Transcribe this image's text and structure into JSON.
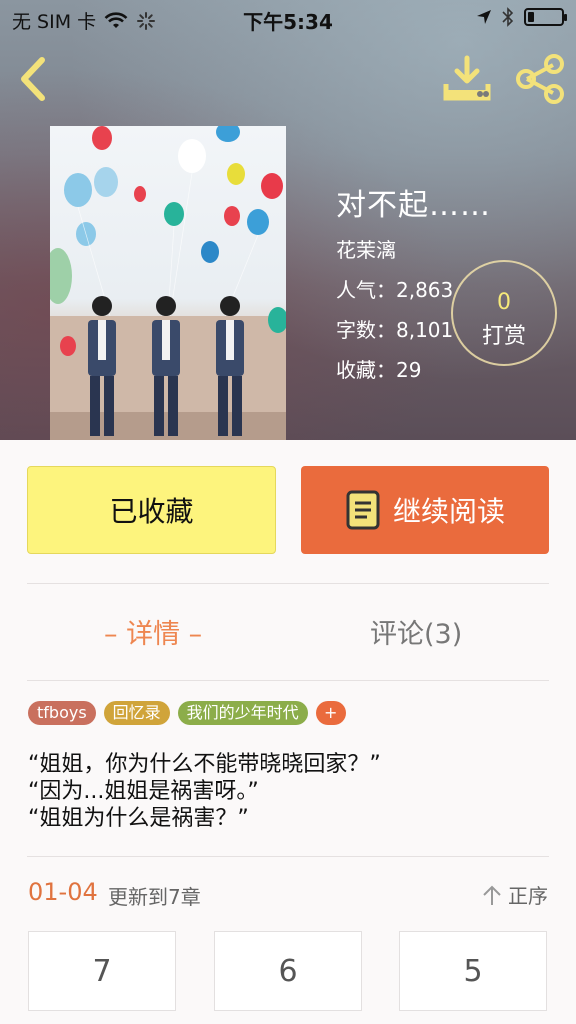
{
  "status_bar": {
    "carrier": "无 SIM 卡",
    "time": "下午5:34",
    "battery_level": 0.2,
    "icons": [
      "wifi-icon",
      "activity-spinner-icon",
      "location-arrow-icon",
      "bluetooth-icon",
      "battery-icon"
    ]
  },
  "nav": {
    "back_icon": "chevron-left-icon",
    "download_icon": "download-icon",
    "share_icon": "share-icon",
    "accent_color": "#f3e27a"
  },
  "book": {
    "title": "对不起……",
    "author": "花茉漓",
    "popularity": "人气：2,863",
    "word_count": "字数：8,101",
    "favorites": "收藏：29"
  },
  "reward": {
    "count": "0",
    "label": "打赏"
  },
  "actions": {
    "favorited_label": "已收藏",
    "continue_label": "继续阅读",
    "favorited_color": "#fdf47d",
    "continue_color": "#ea6b3d"
  },
  "tabs": {
    "detail": "– 详情 –",
    "comments": "评论(3)"
  },
  "tags": [
    {
      "label": "tfboys",
      "color": "#c9705e"
    },
    {
      "label": "回忆录",
      "color": "#d0a43a"
    },
    {
      "label": "我们的少年时代",
      "color": "#8cad4a"
    },
    {
      "label": "+",
      "color": "#ea6b3d"
    }
  ],
  "synopsis": {
    "line1": "“姐姐，你为什么不能带晓晓回家？”",
    "line2": "“因为...姐姐是祸害呀。”",
    "line3": "“姐姐为什么是祸害？”"
  },
  "chapters": {
    "range": "01-04",
    "update_text": "更新到7章",
    "sort_label": "正序",
    "items": [
      "7",
      "6",
      "5"
    ]
  }
}
